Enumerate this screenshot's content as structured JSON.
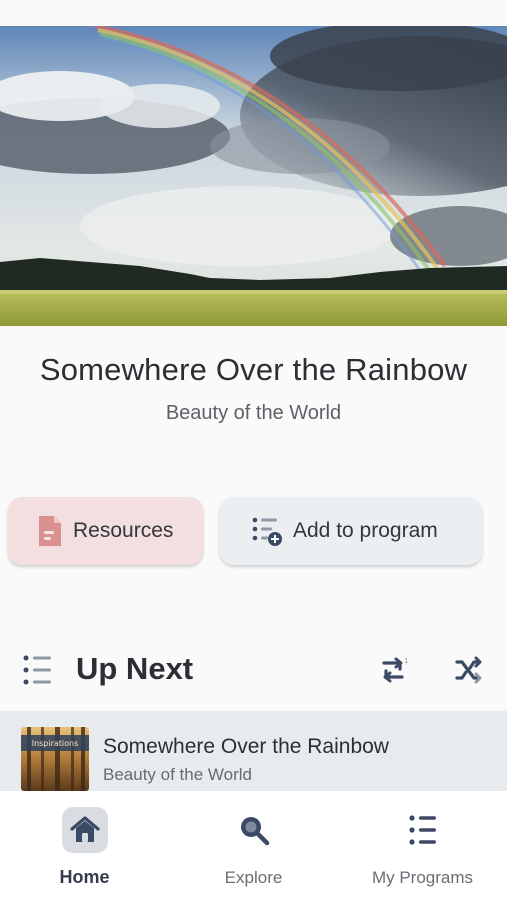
{
  "track": {
    "title": "Somewhere Over the Rainbow",
    "subtitle": "Beauty of the World"
  },
  "actions": {
    "resources_label": "Resources",
    "add_program_label": "Add to program"
  },
  "up_next": {
    "heading": "Up Next",
    "items": [
      {
        "title": "Somewhere Over the Rainbow",
        "subtitle": "Beauty of the World",
        "thumb_brand": "Inspirations"
      }
    ]
  },
  "tabbar": {
    "home": "Home",
    "explore": "Explore",
    "programs": "My Programs",
    "active": "home"
  },
  "icons": {
    "resources": "document-icon",
    "add_program": "playlist-add-icon",
    "list": "list-icon",
    "repeat": "repeat-icon",
    "shuffle": "shuffle-icon",
    "home": "home-icon",
    "explore": "search-icon",
    "programs": "list-icon"
  },
  "colors": {
    "resources_bg": "#f3dfdf",
    "resources_icon": "#d9908f",
    "accent_dark": "#3a4a64",
    "nav_active_bg": "#d9dde2"
  }
}
